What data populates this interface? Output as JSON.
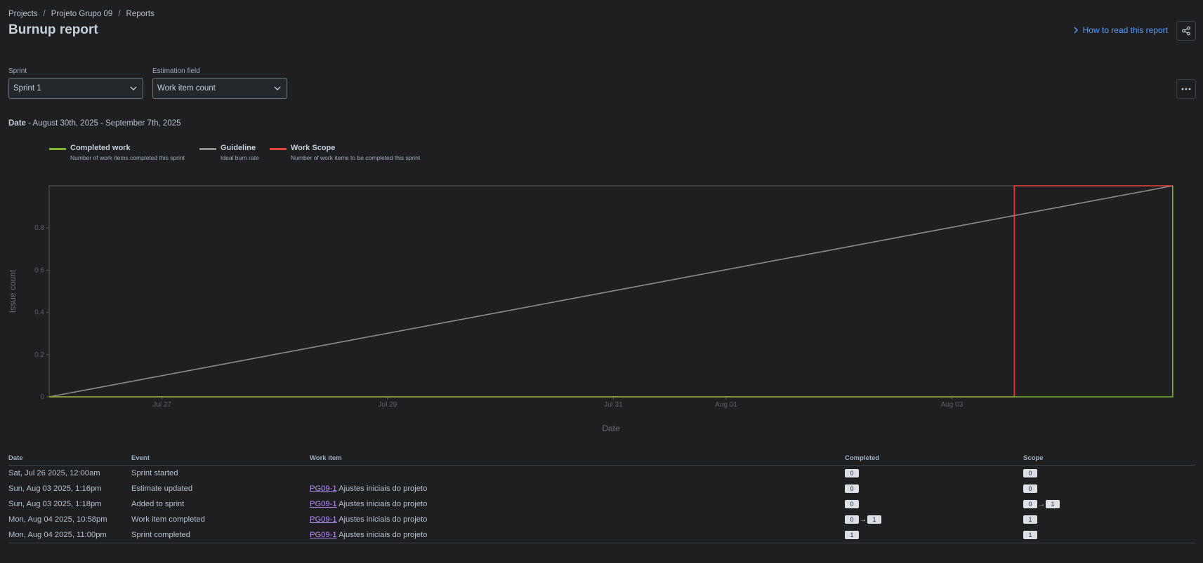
{
  "breadcrumbs": [
    "Projects",
    "Projeto Grupo 09",
    "Reports"
  ],
  "page_title": "Burnup report",
  "how_to_link": "How to read this report",
  "filters": {
    "sprint": {
      "label": "Sprint",
      "value": "Sprint 1"
    },
    "estimation": {
      "label": "Estimation field",
      "value": "Work item count"
    }
  },
  "date_range": {
    "label": "Date",
    "value": " - August 30th, 2025 - September 7th, 2025"
  },
  "legend": [
    {
      "name": "Completed work",
      "desc": "Number of work items completed this sprint",
      "color": "#82b536"
    },
    {
      "name": "Guideline",
      "desc": "Ideal burn rate",
      "color": "#8c8c8c"
    },
    {
      "name": "Work Scope",
      "desc": "Number of work items to be completed this sprint",
      "color": "#e2483d"
    }
  ],
  "chart_data": {
    "type": "line",
    "xlabel": "Date",
    "ylabel": "Issue count",
    "x_ticks": [
      "Jul 27",
      "Jul 29",
      "Jul 31",
      "Aug 01",
      "Aug 03"
    ],
    "y_ticks": [
      "0",
      "0.2",
      "0.4",
      "0.6",
      "0.8"
    ],
    "ylim": [
      0,
      1
    ],
    "xlim": [
      "2025-07-26 00:00",
      "2025-08-04 23:00"
    ],
    "series": [
      {
        "name": "Guideline",
        "color": "#8c8c8c",
        "points": [
          {
            "x": "2025-07-26 00:00",
            "y": 0
          },
          {
            "x": "2025-08-04 23:00",
            "y": 1
          }
        ]
      },
      {
        "name": "Work Scope",
        "color": "#e2483d",
        "points": [
          {
            "x": "2025-07-26 00:00",
            "y": 0
          },
          {
            "x": "2025-08-03 13:18",
            "y": 0
          },
          {
            "x": "2025-08-03 13:18",
            "y": 1
          },
          {
            "x": "2025-08-04 23:00",
            "y": 1
          }
        ]
      },
      {
        "name": "Completed work",
        "color": "#82b536",
        "points": [
          {
            "x": "2025-07-26 00:00",
            "y": 0
          },
          {
            "x": "2025-08-04 22:58",
            "y": 0
          },
          {
            "x": "2025-08-04 22:58",
            "y": 1
          }
        ]
      }
    ]
  },
  "table": {
    "headers": [
      "Date",
      "Event",
      "Work item",
      "Completed",
      "Scope"
    ],
    "rows": [
      {
        "date": "Sat, Jul 26 2025, 12:00am",
        "event": "Sprint started",
        "key": "",
        "summary": "",
        "completed": [
          "0"
        ],
        "scope": [
          "0"
        ]
      },
      {
        "date": "Sun, Aug 03 2025, 1:16pm",
        "event": "Estimate updated",
        "key": "PG09-1",
        "summary": "Ajustes iniciais do projeto",
        "completed": [
          "0"
        ],
        "scope": [
          "0"
        ]
      },
      {
        "date": "Sun, Aug 03 2025, 1:18pm",
        "event": "Added to sprint",
        "key": "PG09-1",
        "summary": "Ajustes iniciais do projeto",
        "completed": [
          "0"
        ],
        "scope": [
          "0",
          "1"
        ]
      },
      {
        "date": "Mon, Aug 04 2025, 10:58pm",
        "event": "Work item completed",
        "key": "PG09-1",
        "summary": "Ajustes iniciais do projeto",
        "completed": [
          "0",
          "1"
        ],
        "scope": [
          "1"
        ]
      },
      {
        "date": "Mon, Aug 04 2025, 11:00pm",
        "event": "Sprint completed",
        "key": "PG09-1",
        "summary": "Ajustes iniciais do projeto",
        "completed": [
          "1"
        ],
        "scope": [
          "1"
        ]
      }
    ]
  }
}
